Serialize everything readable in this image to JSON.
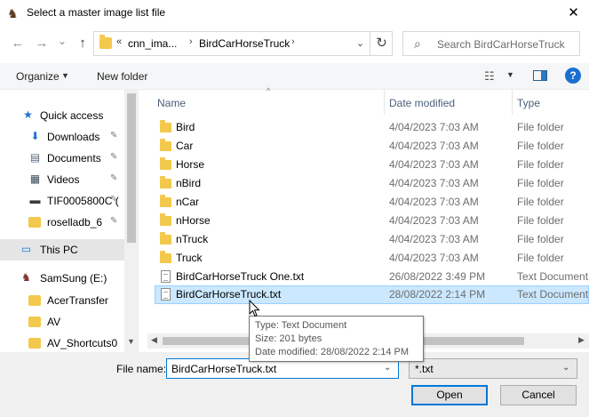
{
  "window": {
    "title": "Select a master image list file",
    "close_glyph": "✕"
  },
  "nav": {
    "back_glyph": "←",
    "forward_glyph": "→",
    "recent_glyph": "⌄",
    "up_glyph": "↑",
    "address_overflow": "«",
    "address_segments": [
      "cnn_ima...",
      "BirdCarHorseTruck"
    ],
    "address_sep": "›",
    "address_dropdown": "⌄",
    "refresh_glyph": "↻",
    "search_placeholder": "Search BirdCarHorseTruck"
  },
  "toolbar": {
    "organize_label": "Organize",
    "new_folder_label": "New folder",
    "dropdown_glyph": "▼",
    "help_glyph": "?"
  },
  "sidebar": {
    "items": [
      {
        "label": "Quick access",
        "icon": "star-icon",
        "glyph": "★",
        "color": "#1c6fd0",
        "pinned": false
      },
      {
        "label": "Downloads",
        "icon": "download-icon",
        "glyph": "⬇",
        "color": "#1c6fd0",
        "pinned": true
      },
      {
        "label": "Documents",
        "icon": "documents-icon",
        "glyph": "▤",
        "color": "#5a6b7c",
        "pinned": true
      },
      {
        "label": "Videos",
        "icon": "videos-icon",
        "glyph": "▦",
        "color": "#3a4a5a",
        "pinned": true
      },
      {
        "label": "TIF0005800C (",
        "icon": "drive-icon",
        "glyph": "▬",
        "color": "#3a3a3a",
        "pinned": true
      },
      {
        "label": "rosellad​b_6",
        "icon": "folder-icon",
        "glyph": "",
        "color": "#f2c94c",
        "pinned": true
      },
      {
        "label": "This PC",
        "icon": "this-pc-icon",
        "glyph": "▭",
        "color": "#1c7fd8",
        "pinned": false
      },
      {
        "label": "SamSung (E:)",
        "icon": "samsung-drive-icon",
        "glyph": "♞",
        "color": "#7a2a2a",
        "pinned": false
      },
      {
        "label": "AcerTransfer",
        "icon": "folder-icon",
        "glyph": "",
        "color": "#f2c94c",
        "pinned": false
      },
      {
        "label": "AV",
        "icon": "folder-icon",
        "glyph": "",
        "color": "#f2c94c",
        "pinned": false
      },
      {
        "label": "AV_Shortcuts0",
        "icon": "folder-icon",
        "glyph": "",
        "color": "#f2c94c",
        "pinned": false
      }
    ],
    "pin_glyph": "📌",
    "scroll_down_glyph": "▼"
  },
  "columns": {
    "name": "Name",
    "date": "Date modified",
    "type": "Type",
    "sort_glyph": "^"
  },
  "files": [
    {
      "name": "Bird",
      "date": "4/04/2023 7:03 AM",
      "type": "File folder",
      "kind": "folder"
    },
    {
      "name": "Car",
      "date": "4/04/2023 7:03 AM",
      "type": "File folder",
      "kind": "folder"
    },
    {
      "name": "Horse",
      "date": "4/04/2023 7:03 AM",
      "type": "File folder",
      "kind": "folder"
    },
    {
      "name": "nBird",
      "date": "4/04/2023 7:03 AM",
      "type": "File folder",
      "kind": "folder"
    },
    {
      "name": "nCar",
      "date": "4/04/2023 7:03 AM",
      "type": "File folder",
      "kind": "folder"
    },
    {
      "name": "nHorse",
      "date": "4/04/2023 7:03 AM",
      "type": "File folder",
      "kind": "folder"
    },
    {
      "name": "nTruck",
      "date": "4/04/2023 7:03 AM",
      "type": "File folder",
      "kind": "folder"
    },
    {
      "name": "Truck",
      "date": "4/04/2023 7:03 AM",
      "type": "File folder",
      "kind": "folder"
    },
    {
      "name": "BirdCarHorseTruck One.txt",
      "date": "26/08/2022 3:49 PM",
      "type": "Text Document",
      "kind": "text"
    },
    {
      "name": "BirdCarHorseTruck.txt",
      "date": "28/08/2022 2:14 PM",
      "type": "Text Document",
      "kind": "text",
      "selected": true
    }
  ],
  "hscroll": {
    "left_glyph": "◀",
    "right_glyph": "▶"
  },
  "tooltip": {
    "type_line": "Type: Text Document",
    "size_line": "Size: 201 bytes",
    "date_line": "Date modified: 28/08/2022 2:14 PM"
  },
  "footer": {
    "filename_label": "File name:",
    "filename_value": "BirdCarHorseTruck.txt",
    "filter_value": "*.txt",
    "dropdown_glyph": "⌄",
    "open_label": "Open",
    "cancel_label": "Cancel"
  },
  "colors": {
    "selection_bg": "#cce8ff",
    "accent": "#0078d7"
  }
}
